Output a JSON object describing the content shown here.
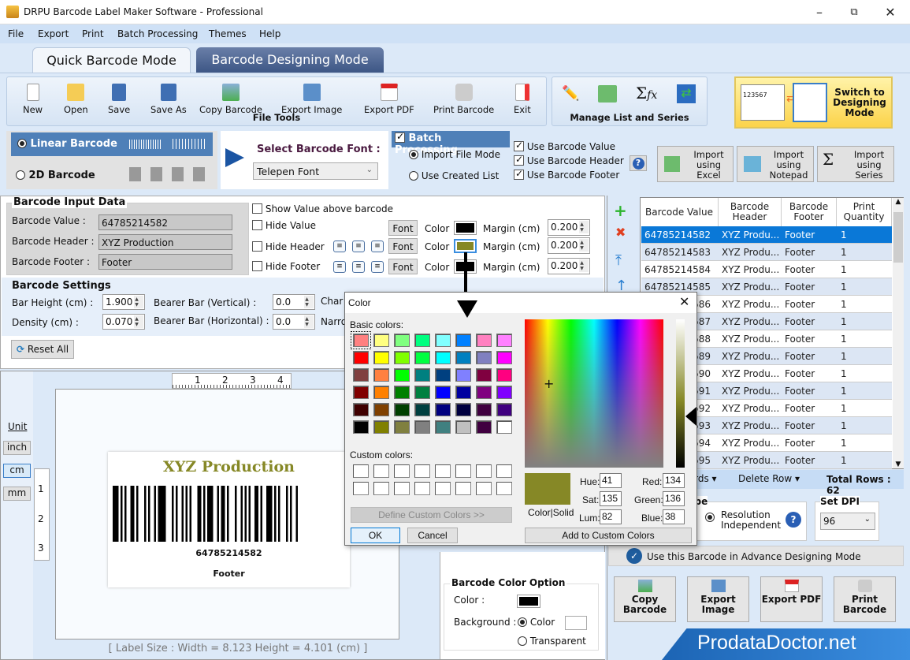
{
  "window": {
    "title": "DRPU Barcode Label Maker Software - Professional"
  },
  "menu": [
    "File",
    "Export",
    "Print",
    "Batch Processing",
    "Themes",
    "Help"
  ],
  "tabs": {
    "quick": "Quick Barcode Mode",
    "designing": "Barcode Designing Mode"
  },
  "file_tools": {
    "title": "File Tools",
    "items": [
      "New",
      "Open",
      "Save",
      "Save As",
      "Copy Barcode",
      "Export Image",
      "Export PDF",
      "Print Barcode",
      "Exit"
    ]
  },
  "manage": {
    "title": "Manage List and Series"
  },
  "switch": {
    "label": "Switch to Designing Mode",
    "preview_number": "123567"
  },
  "barcode_type": {
    "linear": "Linear Barcode",
    "twod": "2D Barcode",
    "selected": "linear"
  },
  "font_select": {
    "label": "Select Barcode Font :",
    "value": "Telepen Font"
  },
  "batch": {
    "title": "Batch Processing",
    "enabled": true,
    "import_file": "Import File Mode",
    "use_list": "Use Created List",
    "use_value": "Use Barcode Value",
    "use_header": "Use Barcode Header",
    "use_footer": "Use Barcode Footer",
    "import_excel": "Import using Excel",
    "import_notepad": "Import using Notepad",
    "import_series": "Import using Series"
  },
  "input": {
    "title": "Barcode Input Data",
    "value_label": "Barcode Value :",
    "value": "64785214582",
    "header_label": "Barcode Header :",
    "header": "XYZ Production",
    "footer_label": "Barcode Footer :",
    "footer": "Footer"
  },
  "options": {
    "show_above": "Show Value above barcode",
    "hide_value": "Hide Value",
    "hide_header": "Hide Header",
    "hide_footer": "Hide Footer",
    "font": "Font",
    "color": "Color",
    "margin": "Margin (cm)",
    "margins": [
      "0.200",
      "0.200",
      "0.200"
    ],
    "colors": {
      "value": "#000000",
      "header": "#868826",
      "footer": "#000000"
    }
  },
  "settings": {
    "title": "Barcode Settings",
    "bar_height_label": "Bar Height (cm) :",
    "bar_height": "1.900",
    "density_label": "Density (cm) :",
    "density": "0.070",
    "bearer_v_label": "Bearer Bar (Vertical) :",
    "bearer_v": "0.0",
    "bearer_h_label": "Bearer Bar (Horizontal) :",
    "bearer_h": "0.0",
    "char_label": "Char",
    "narrow_label": "Narro",
    "reset": "Reset All"
  },
  "canvas": {
    "unit_label": "Unit",
    "units": [
      "inch",
      "cm",
      "mm"
    ],
    "selected_unit": "cm",
    "ruler_h": [
      "1",
      "2",
      "3",
      "4"
    ],
    "ruler_v": [
      "1",
      "2",
      "3"
    ],
    "label_header": "XYZ Production",
    "label_value": "64785214582",
    "label_footer": "Footer",
    "status": "[ Label Size : Width = 8.123  Height = 4.101 (cm) ]"
  },
  "color_option": {
    "title": "Barcode Color Option",
    "color_label": "Color :",
    "bg_label": "Background :",
    "bg_color": "Color",
    "bg_transparent": "Transparent",
    "bar_color": "#000000",
    "bg_value": "#ffffff"
  },
  "table": {
    "headers": [
      "Barcode Value",
      "Barcode Header",
      "Barcode Footer",
      "Print Quantity"
    ],
    "rows": [
      [
        "64785214582",
        "XYZ Produ...",
        "Footer",
        "1"
      ],
      [
        "64785214583",
        "XYZ Produ...",
        "Footer",
        "1"
      ],
      [
        "64785214584",
        "XYZ Produ...",
        "Footer",
        "1"
      ],
      [
        "64785214585",
        "XYZ Produ...",
        "Footer",
        "1"
      ],
      [
        "64785214586",
        "XYZ Produ...",
        "Footer",
        "1"
      ],
      [
        "64785214587",
        "XYZ Produ...",
        "Footer",
        "1"
      ],
      [
        "64785214588",
        "XYZ Produ...",
        "Footer",
        "1"
      ],
      [
        "64785214589",
        "XYZ Produ...",
        "Footer",
        "1"
      ],
      [
        "64785214590",
        "XYZ Produ...",
        "Footer",
        "1"
      ],
      [
        "64785214591",
        "XYZ Produ...",
        "Footer",
        "1"
      ],
      [
        "64785214592",
        "XYZ Produ...",
        "Footer",
        "1"
      ],
      [
        "64785214593",
        "XYZ Produ...",
        "Footer",
        "1"
      ],
      [
        "64785214594",
        "XYZ Produ...",
        "Footer",
        "1"
      ],
      [
        "64785214595",
        "XYZ Produ...",
        "Footer",
        "1"
      ]
    ],
    "selected_row": 0,
    "records_menu": "Records",
    "delete_row": "Delete Row",
    "total_rows": "Total Rows : 62"
  },
  "image_type": {
    "title": "Image Type",
    "option": "Resolution Independent"
  },
  "dpi": {
    "title": "Set DPI",
    "value": "96"
  },
  "advance": "Use this Barcode in Advance Designing Mode",
  "actions": [
    "Copy Barcode",
    "Export Image",
    "Export PDF",
    "Print Barcode"
  ],
  "brand": "ProdataDoctor.net",
  "color_dialog": {
    "title": "Color",
    "basic_label": "Basic colors:",
    "custom_label": "Custom colors:",
    "define": "Define Custom Colors >>",
    "ok": "OK",
    "cancel": "Cancel",
    "add": "Add to Custom Colors",
    "color_solid": "Color|Solid",
    "hue_label": "Hue:",
    "hue": "41",
    "sat_label": "Sat:",
    "sat": "135",
    "lum_label": "Lum:",
    "lum": "82",
    "red_label": "Red:",
    "red": "134",
    "green_label": "Green:",
    "green": "136",
    "blue_label": "Blue:",
    "blue": "38",
    "current_color": "#868826",
    "basic_colors": [
      "#ff8080",
      "#ffff80",
      "#80ff80",
      "#00ff80",
      "#80ffff",
      "#0080ff",
      "#ff80c0",
      "#ff80ff",
      "#ff0000",
      "#ffff00",
      "#80ff00",
      "#00ff40",
      "#00ffff",
      "#0080c0",
      "#8080c0",
      "#ff00ff",
      "#804040",
      "#ff8040",
      "#00ff00",
      "#008080",
      "#004080",
      "#8080ff",
      "#800040",
      "#ff0080",
      "#800000",
      "#ff8000",
      "#008000",
      "#008040",
      "#0000ff",
      "#0000a0",
      "#800080",
      "#8000ff",
      "#400000",
      "#804000",
      "#004000",
      "#004040",
      "#000080",
      "#000040",
      "#400040",
      "#400080",
      "#000000",
      "#808000",
      "#808040",
      "#808080",
      "#408080",
      "#c0c0c0",
      "#400040",
      "#ffffff"
    ]
  }
}
